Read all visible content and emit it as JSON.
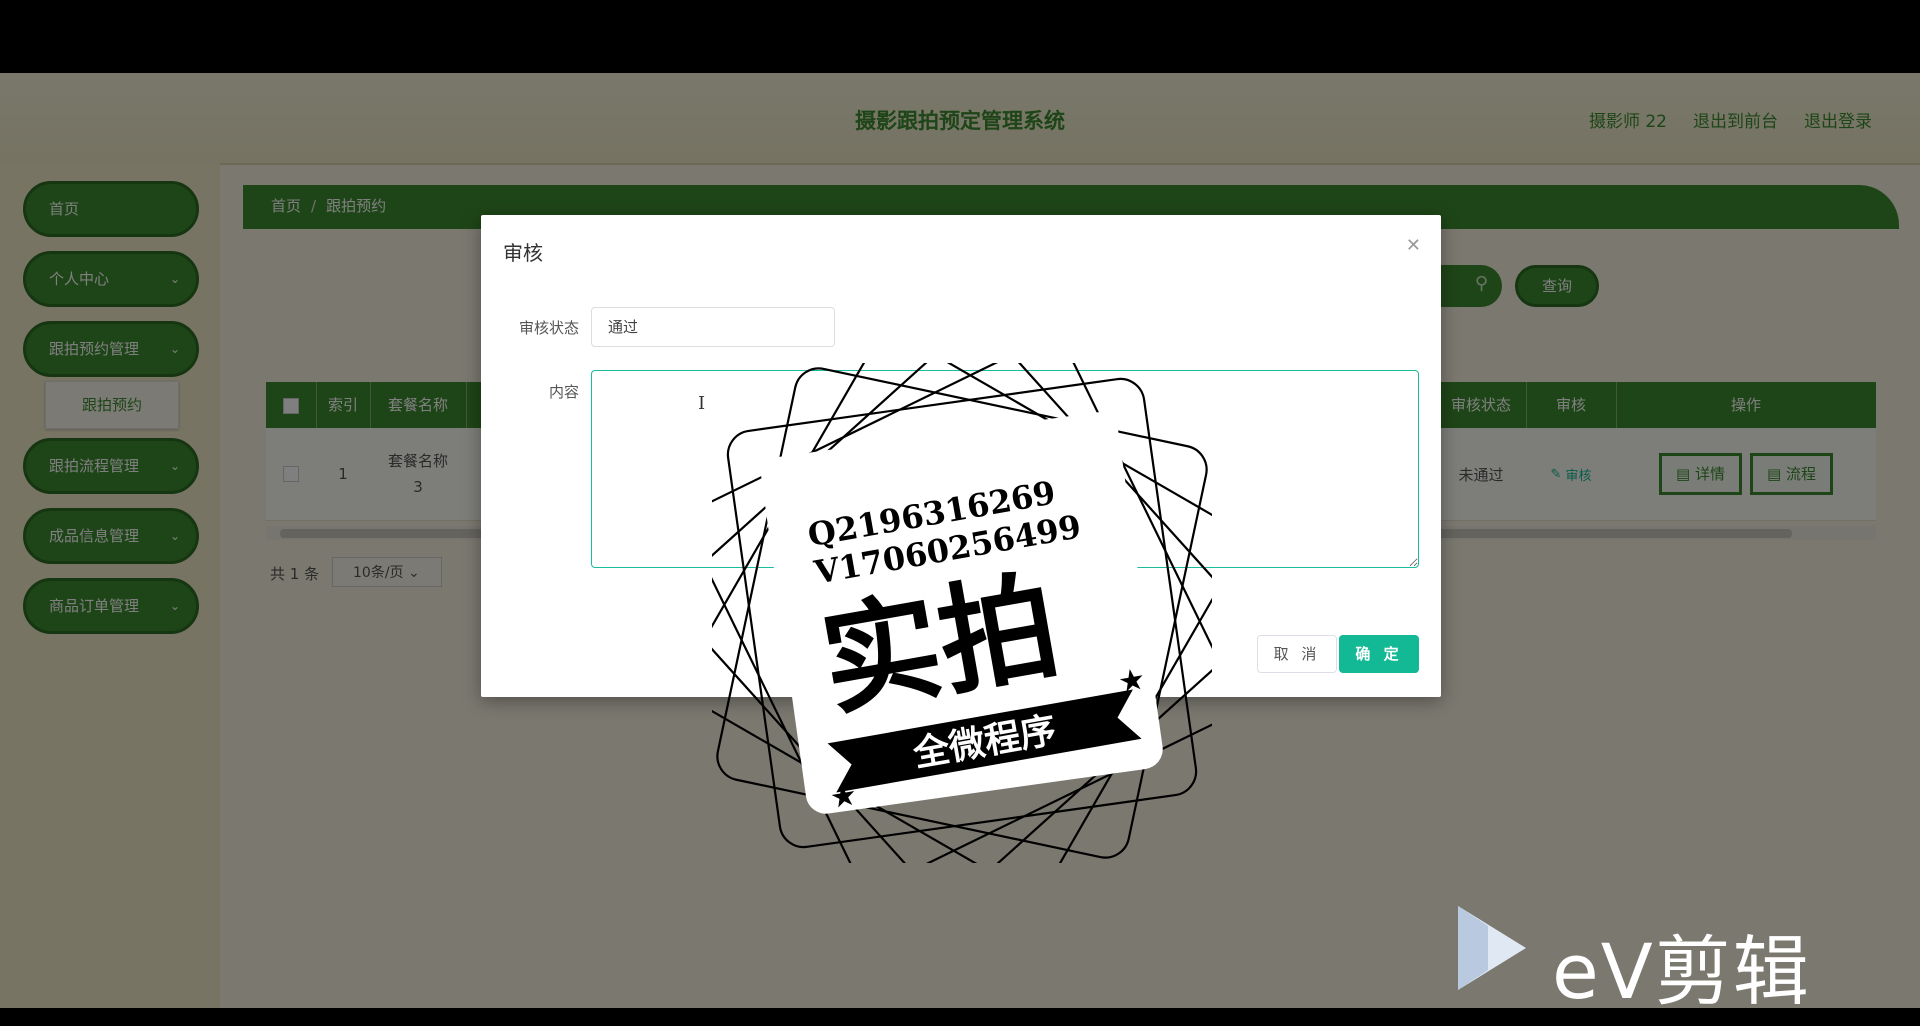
{
  "header": {
    "title": "摄影跟拍预定管理系统",
    "user": "摄影师 22",
    "to_front": "退出到前台",
    "logout": "退出登录"
  },
  "sidebar": {
    "items": [
      {
        "label": "首页"
      },
      {
        "label": "个人中心"
      },
      {
        "label": "跟拍预约管理"
      },
      {
        "label": "跟拍流程管理"
      },
      {
        "label": "成品信息管理"
      },
      {
        "label": "商品订单管理"
      }
    ],
    "sub_item": "跟拍预约"
  },
  "breadcrumb": {
    "home": "首页",
    "sep": "/",
    "current": "跟拍预约"
  },
  "search": {
    "query_label": "查询"
  },
  "table": {
    "headers": {
      "index": "索引",
      "package": "套餐名称",
      "audit_status": "审核状态",
      "audit": "审核",
      "ops": "操作"
    },
    "row": {
      "index": "1",
      "package": "套餐名称3",
      "audit_status": "未通过",
      "audit_action": "审核",
      "detail": "详情",
      "flow": "流程"
    }
  },
  "pager": {
    "total": "共 1 条",
    "page_size": "10条/页"
  },
  "dialog": {
    "title": "审核",
    "status_label": "审核状态",
    "status_value": "通过",
    "content_label": "内容",
    "content_value": "",
    "cancel": "取 消",
    "ok": "确 定"
  },
  "watermark": {
    "line1": "Q2196316269",
    "line2": "V17060256499",
    "big": "实拍",
    "banner": "全微程序"
  },
  "ev": {
    "text": "eV剪辑"
  }
}
